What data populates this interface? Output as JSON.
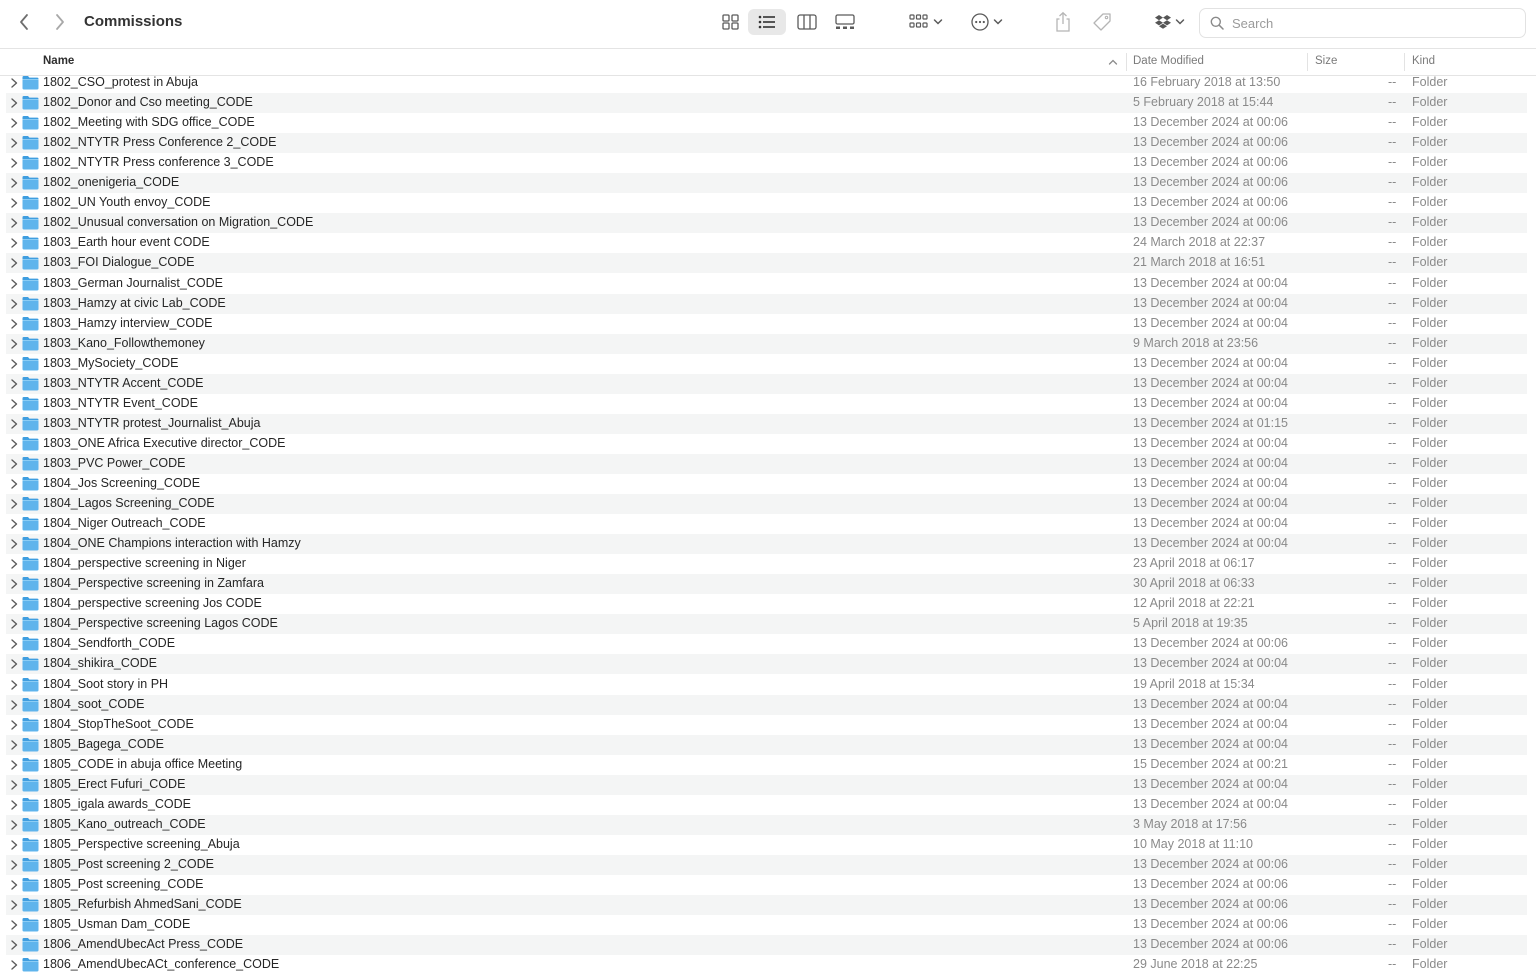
{
  "window": {
    "title": "Commissions",
    "search_placeholder": "Search"
  },
  "icons": {
    "back": "chevron-left-icon",
    "forward": "chevron-right-icon",
    "view_icons": "grid-view-icon",
    "view_list": "list-view-icon",
    "view_columns": "column-view-icon",
    "view_gallery": "gallery-view-icon",
    "group": "group-by-icon",
    "action": "ellipsis-circle-icon",
    "share": "share-icon",
    "tag": "tag-icon",
    "dropbox": "dropbox-icon",
    "search": "search-icon",
    "folder": "folder-icon",
    "sort": "sort-ascending-icon"
  },
  "colors": {
    "folder": "#5fb4ec",
    "folder_tab": "#3f9ee0",
    "row_alt": "#f4f5f5",
    "secondary_text": "#8a8a8a"
  },
  "columns": {
    "name": "Name",
    "date": "Date Modified",
    "size": "Size",
    "kind": "Kind"
  },
  "rows": [
    {
      "name": "1802_CSO_protest in Abuja",
      "date": "16 February 2018 at 13:50",
      "size": "--",
      "kind": "Folder"
    },
    {
      "name": "1802_Donor and Cso meeting_CODE",
      "date": "5 February 2018 at 15:44",
      "size": "--",
      "kind": "Folder"
    },
    {
      "name": "1802_Meeting with SDG office_CODE",
      "date": "13 December 2024 at 00:06",
      "size": "--",
      "kind": "Folder"
    },
    {
      "name": "1802_NTYTR Press Conference 2_CODE",
      "date": "13 December 2024 at 00:06",
      "size": "--",
      "kind": "Folder"
    },
    {
      "name": "1802_NTYTR Press conference 3_CODE",
      "date": "13 December 2024 at 00:06",
      "size": "--",
      "kind": "Folder"
    },
    {
      "name": "1802_onenigeria_CODE",
      "date": "13 December 2024 at 00:06",
      "size": "--",
      "kind": "Folder"
    },
    {
      "name": "1802_UN Youth envoy_CODE",
      "date": "13 December 2024 at 00:06",
      "size": "--",
      "kind": "Folder"
    },
    {
      "name": "1802_Unusual conversation on Migration_CODE",
      "date": "13 December 2024 at 00:06",
      "size": "--",
      "kind": "Folder"
    },
    {
      "name": "1803_Earth hour event CODE",
      "date": "24 March 2018 at 22:37",
      "size": "--",
      "kind": "Folder"
    },
    {
      "name": "1803_FOI Dialogue_CODE",
      "date": "21 March 2018 at 16:51",
      "size": "--",
      "kind": "Folder"
    },
    {
      "name": "1803_German Journalist_CODE",
      "date": "13 December 2024 at 00:04",
      "size": "--",
      "kind": "Folder"
    },
    {
      "name": "1803_Hamzy at civic Lab_CODE",
      "date": "13 December 2024 at 00:04",
      "size": "--",
      "kind": "Folder"
    },
    {
      "name": "1803_Hamzy interview_CODE",
      "date": "13 December 2024 at 00:04",
      "size": "--",
      "kind": "Folder"
    },
    {
      "name": "1803_Kano_Followthemoney",
      "date": "9 March 2018 at 23:56",
      "size": "--",
      "kind": "Folder"
    },
    {
      "name": "1803_MySociety_CODE",
      "date": "13 December 2024 at 00:04",
      "size": "--",
      "kind": "Folder"
    },
    {
      "name": "1803_NTYTR Accent_CODE",
      "date": "13 December 2024 at 00:04",
      "size": "--",
      "kind": "Folder"
    },
    {
      "name": "1803_NTYTR Event_CODE",
      "date": "13 December 2024 at 00:04",
      "size": "--",
      "kind": "Folder"
    },
    {
      "name": "1803_NTYTR protest_Journalist_Abuja",
      "date": "13 December 2024 at 01:15",
      "size": "--",
      "kind": "Folder"
    },
    {
      "name": "1803_ONE Africa Executive director_CODE",
      "date": "13 December 2024 at 00:04",
      "size": "--",
      "kind": "Folder"
    },
    {
      "name": "1803_PVC Power_CODE",
      "date": "13 December 2024 at 00:04",
      "size": "--",
      "kind": "Folder"
    },
    {
      "name": "1804_Jos Screening_CODE",
      "date": "13 December 2024 at 00:04",
      "size": "--",
      "kind": "Folder"
    },
    {
      "name": "1804_Lagos Screening_CODE",
      "date": "13 December 2024 at 00:04",
      "size": "--",
      "kind": "Folder"
    },
    {
      "name": "1804_Niger Outreach_CODE",
      "date": "13 December 2024 at 00:04",
      "size": "--",
      "kind": "Folder"
    },
    {
      "name": "1804_ONE Champions interaction with Hamzy",
      "date": "13 December 2024 at 00:04",
      "size": "--",
      "kind": "Folder"
    },
    {
      "name": "1804_perspective screening in Niger",
      "date": "23 April 2018 at 06:17",
      "size": "--",
      "kind": "Folder"
    },
    {
      "name": "1804_Perspective screening in Zamfara",
      "date": "30 April 2018 at 06:33",
      "size": "--",
      "kind": "Folder"
    },
    {
      "name": "1804_perspective screening Jos CODE",
      "date": "12 April 2018 at 22:21",
      "size": "--",
      "kind": "Folder"
    },
    {
      "name": "1804_Perspective screening Lagos CODE",
      "date": "5 April 2018 at 19:35",
      "size": "--",
      "kind": "Folder"
    },
    {
      "name": "1804_Sendforth_CODE",
      "date": "13 December 2024 at 00:06",
      "size": "--",
      "kind": "Folder"
    },
    {
      "name": "1804_shikira_CODE",
      "date": "13 December 2024 at 00:04",
      "size": "--",
      "kind": "Folder"
    },
    {
      "name": "1804_Soot story in PH",
      "date": "19 April 2018 at 15:34",
      "size": "--",
      "kind": "Folder"
    },
    {
      "name": "1804_soot_CODE",
      "date": "13 December 2024 at 00:04",
      "size": "--",
      "kind": "Folder"
    },
    {
      "name": "1804_StopTheSoot_CODE",
      "date": "13 December 2024 at 00:04",
      "size": "--",
      "kind": "Folder"
    },
    {
      "name": "1805_Bagega_CODE",
      "date": "13 December 2024 at 00:04",
      "size": "--",
      "kind": "Folder"
    },
    {
      "name": "1805_CODE in abuja office Meeting",
      "date": "15 December 2024 at 00:21",
      "size": "--",
      "kind": "Folder"
    },
    {
      "name": "1805_Erect Fufuri_CODE",
      "date": "13 December 2024 at 00:04",
      "size": "--",
      "kind": "Folder"
    },
    {
      "name": "1805_igala awards_CODE",
      "date": "13 December 2024 at 00:04",
      "size": "--",
      "kind": "Folder"
    },
    {
      "name": "1805_Kano_outreach_CODE",
      "date": "3 May 2018 at 17:56",
      "size": "--",
      "kind": "Folder"
    },
    {
      "name": "1805_Perspective screening_Abuja",
      "date": "10 May 2018 at 11:10",
      "size": "--",
      "kind": "Folder"
    },
    {
      "name": "1805_Post screening 2_CODE",
      "date": "13 December 2024 at 00:06",
      "size": "--",
      "kind": "Folder"
    },
    {
      "name": "1805_Post screening_CODE",
      "date": "13 December 2024 at 00:06",
      "size": "--",
      "kind": "Folder"
    },
    {
      "name": "1805_Refurbish AhmedSani_CODE",
      "date": "13 December 2024 at 00:06",
      "size": "--",
      "kind": "Folder"
    },
    {
      "name": "1805_Usman Dam_CODE",
      "date": "13 December 2024 at 00:06",
      "size": "--",
      "kind": "Folder"
    },
    {
      "name": "1806_AmendUbecAct Press_CODE",
      "date": "13 December 2024 at 00:06",
      "size": "--",
      "kind": "Folder"
    },
    {
      "name": "1806_AmendUbecACt_conference_CODE",
      "date": "29 June 2018 at 22:25",
      "size": "--",
      "kind": "Folder"
    }
  ]
}
